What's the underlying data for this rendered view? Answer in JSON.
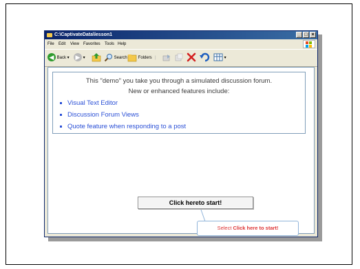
{
  "window": {
    "title": "C:\\CaptivateData\\lesson1"
  },
  "menu": {
    "items": [
      "File",
      "Edit",
      "View",
      "Favorites",
      "Tools",
      "Help"
    ]
  },
  "toolbar": {
    "back_label": "Back",
    "search_label": "Search",
    "folders_label": "Folders"
  },
  "content": {
    "intro": "This \"demo\" you take you through a simulated discussion forum.",
    "subintro": "New or enhanced features include:",
    "features": [
      "Visual Text Editor",
      "Discussion Forum Views",
      "Quote feature when responding to a post"
    ]
  },
  "start_button": {
    "label": "Click hereto start!"
  },
  "callout": {
    "prefix": "Select",
    "emphasis": "Click here to start!"
  },
  "colors": {
    "title_start": "#0a246a",
    "title_end": "#3a6ea5",
    "link": "#2a4fd6",
    "callout_text": "#d33333"
  }
}
